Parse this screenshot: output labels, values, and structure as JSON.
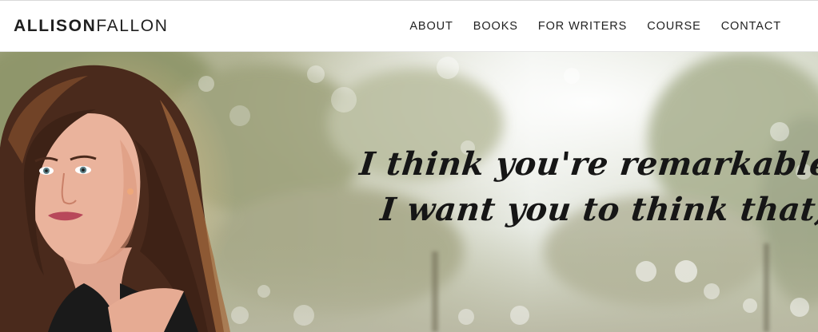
{
  "site": {
    "logo_first": "ALLISON",
    "logo_last": "FALLON"
  },
  "nav": {
    "items": [
      {
        "label": "ABOUT"
      },
      {
        "label": "BOOKS"
      },
      {
        "label": "FOR WRITERS"
      },
      {
        "label": "COURSE"
      },
      {
        "label": "CONTACT"
      }
    ]
  },
  "hero": {
    "quote_line_1": "I think you're remarkable and",
    "quote_line_2": "I want you to think that, too."
  },
  "colors": {
    "text_dark": "#1f1f1f",
    "header_bg": "#ffffff",
    "hero_tone": "#b8b99a"
  }
}
